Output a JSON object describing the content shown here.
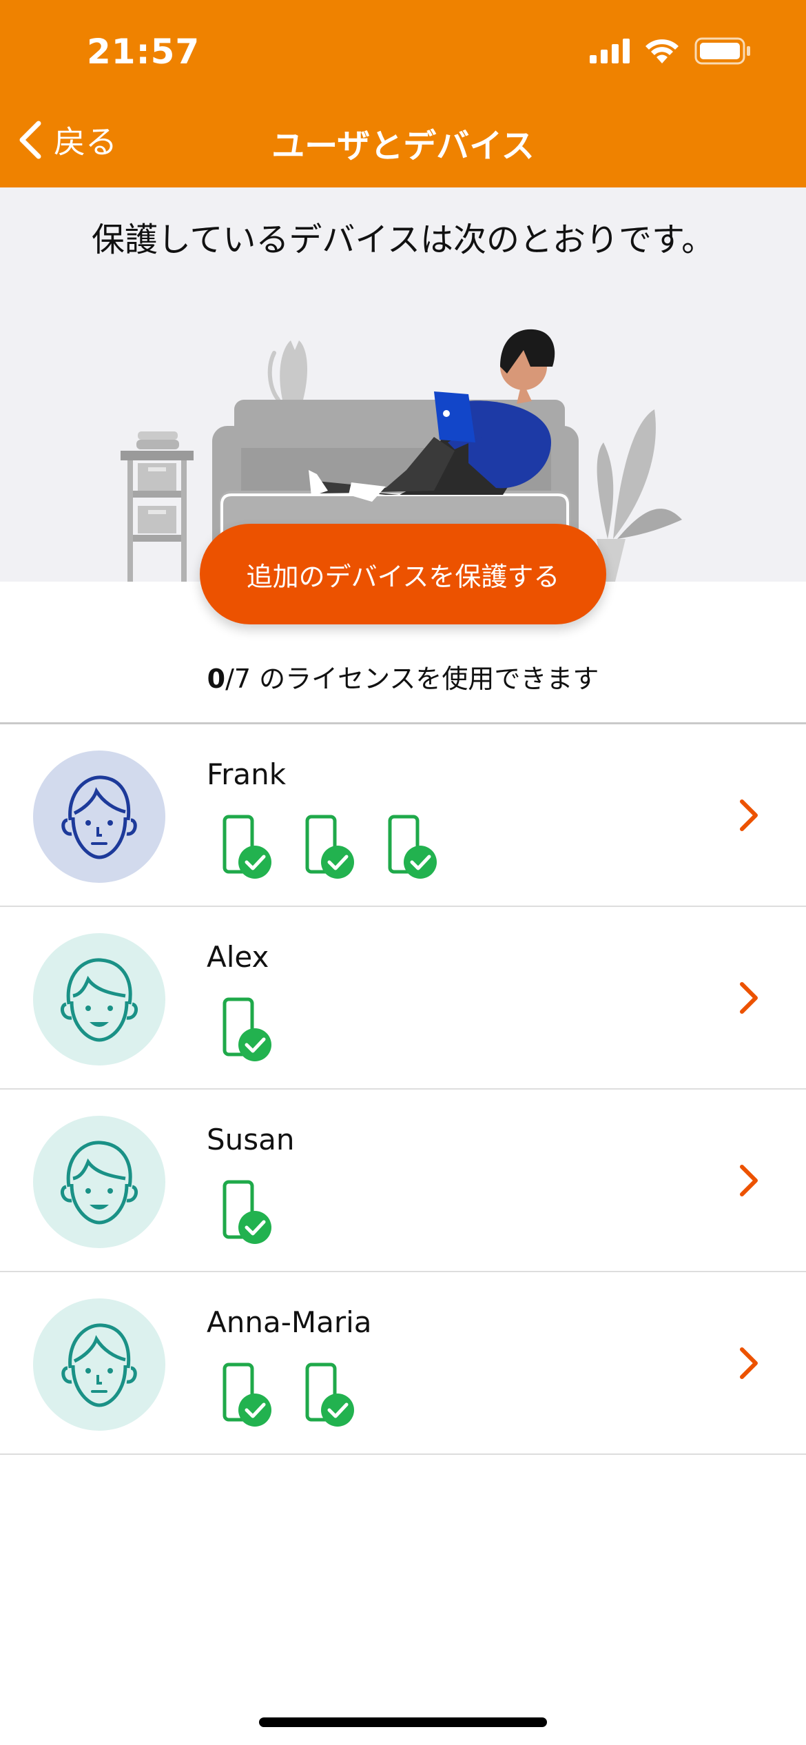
{
  "status_bar": {
    "time": "21:57"
  },
  "nav": {
    "back_label": "戻る",
    "title": "ユーザとデバイス"
  },
  "hero": {
    "text": "保護しているデバイスは次のとおりです。"
  },
  "add_button": {
    "label": "追加のデバイスを保護する"
  },
  "license": {
    "used": "0",
    "rest": "/7 のライセンスを使用できます"
  },
  "users": [
    {
      "name": "Frank",
      "avatar_color": "#d2daed",
      "device_count": 3
    },
    {
      "name": "Alex",
      "avatar_color": "#dcf1ee",
      "device_count": 1
    },
    {
      "name": "Susan",
      "avatar_color": "#dcf1ee",
      "device_count": 1
    },
    {
      "name": "Anna-Maria",
      "avatar_color": "#dcf1ee",
      "device_count": 2
    }
  ],
  "colors": {
    "header": "#ef8200",
    "accent": "#ec5200",
    "device": "#1fa94a",
    "check": "#22b24f"
  }
}
